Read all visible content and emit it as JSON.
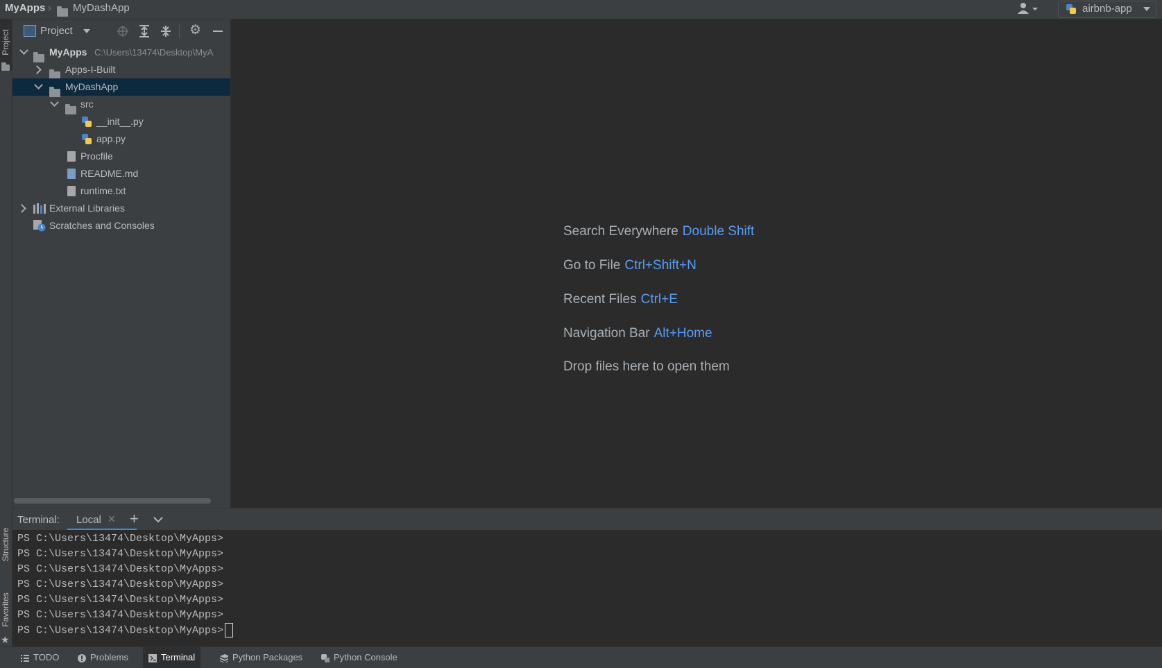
{
  "titlebar": {
    "root": "MyApps",
    "separator": "›",
    "current": "MyDashApp",
    "run_config": "airbnb-app"
  },
  "left_stripe": {
    "project_label": "Project",
    "structure_label": "Structure",
    "favorites_label": "Favorites"
  },
  "project_panel": {
    "title": "Project",
    "tree": [
      {
        "label": "MyApps",
        "path": "C:\\Users\\13474\\Desktop\\MyA",
        "type": "folder",
        "expanded": true
      },
      {
        "label": "Apps-I-Built",
        "type": "folder",
        "expanded": false
      },
      {
        "label": "MyDashApp",
        "type": "folder",
        "expanded": true,
        "selected": true
      },
      {
        "label": "src",
        "type": "folder",
        "expanded": true
      },
      {
        "label": "__init__.py",
        "type": "python"
      },
      {
        "label": "app.py",
        "type": "python"
      },
      {
        "label": "Procfile",
        "type": "file"
      },
      {
        "label": "README.md",
        "type": "markdown"
      },
      {
        "label": "runtime.txt",
        "type": "file"
      },
      {
        "label": "External Libraries",
        "type": "library",
        "expanded": false
      },
      {
        "label": "Scratches and Consoles",
        "type": "scratch"
      }
    ]
  },
  "editor": {
    "hints": [
      {
        "text": "Search Everywhere",
        "key": "Double Shift"
      },
      {
        "text": "Go to File",
        "key": "Ctrl+Shift+N"
      },
      {
        "text": "Recent Files",
        "key": "Ctrl+E"
      },
      {
        "text": "Navigation Bar",
        "key": "Alt+Home"
      },
      {
        "text": "Drop files here to open them",
        "key": ""
      }
    ]
  },
  "terminal": {
    "label": "Terminal:",
    "tab": "Local",
    "lines": [
      "PS C:\\Users\\13474\\Desktop\\MyApps>",
      "PS C:\\Users\\13474\\Desktop\\MyApps>",
      "PS C:\\Users\\13474\\Desktop\\MyApps>",
      "PS C:\\Users\\13474\\Desktop\\MyApps>",
      "PS C:\\Users\\13474\\Desktop\\MyApps>",
      "PS C:\\Users\\13474\\Desktop\\MyApps>",
      "PS C:\\Users\\13474\\Desktop\\MyApps>"
    ]
  },
  "bottom_tabs": [
    {
      "label": "TODO",
      "icon": "list-icon"
    },
    {
      "label": "Problems",
      "icon": "info-icon"
    },
    {
      "label": "Terminal",
      "icon": "terminal-icon",
      "active": true
    },
    {
      "label": "Python Packages",
      "icon": "packages-icon"
    },
    {
      "label": "Python Console",
      "icon": "python-icon"
    }
  ],
  "colors": {
    "accent_key": "#589df6",
    "selection": "#0d293e",
    "panel": "#3c3f41",
    "editor": "#2b2b2b"
  }
}
